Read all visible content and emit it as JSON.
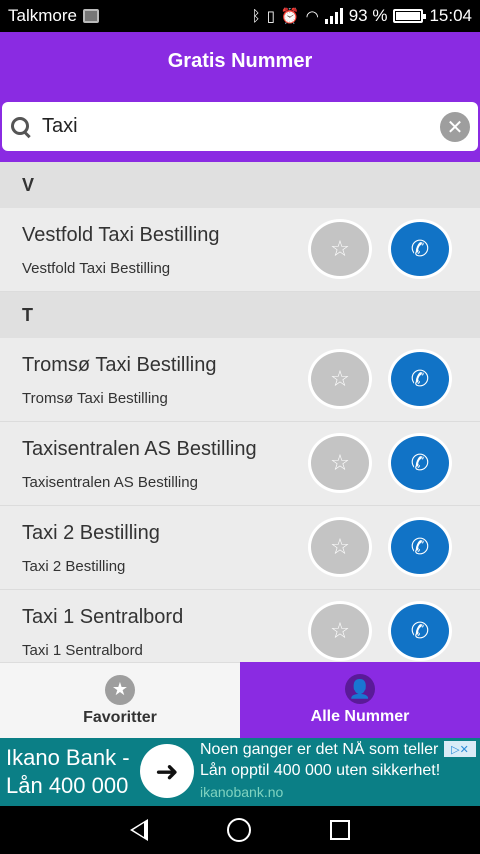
{
  "status_bar": {
    "carrier": "Talkmore",
    "battery_text": "93 %",
    "time": "15:04",
    "icons": [
      "image-icon",
      "bluetooth-icon",
      "vibrate-icon",
      "alarm-icon",
      "wifi-icon",
      "signal-icon",
      "battery-icon"
    ]
  },
  "app_bar": {
    "title": "Gratis Nummer"
  },
  "search": {
    "value": "Taxi",
    "placeholder": ""
  },
  "sections": [
    {
      "letter": "V",
      "items": [
        {
          "name": "Vestfold Taxi Bestilling",
          "subtitle": "Vestfold Taxi Bestilling"
        }
      ]
    },
    {
      "letter": "T",
      "items": [
        {
          "name": "Tromsø Taxi Bestilling",
          "subtitle": "Tromsø Taxi Bestilling"
        },
        {
          "name": "Taxisentralen AS Bestilling",
          "subtitle": "Taxisentralen AS Bestilling"
        },
        {
          "name": "Taxi 2 Bestilling",
          "subtitle": "Taxi 2 Bestilling"
        },
        {
          "name": "Taxi 1 Sentralbord",
          "subtitle": "Taxi 1 Sentralbord"
        }
      ]
    }
  ],
  "tabs": {
    "favorites_label": "Favoritter",
    "all_label": "Alle Nummer",
    "active": "all"
  },
  "ad": {
    "brand_line1": "Ikano Bank -",
    "brand_line2": "Lån 400 000",
    "headline": "Noen ganger er det NÅ som teller",
    "body": "Lån opptil 400 000 uten sikkerhet!",
    "domain": "ikanobank.no"
  },
  "colors": {
    "primary": "#8a2be2",
    "call_button": "#1173c6",
    "fav_button": "#c4c4c4",
    "ad_bg": "#0b7f86"
  }
}
